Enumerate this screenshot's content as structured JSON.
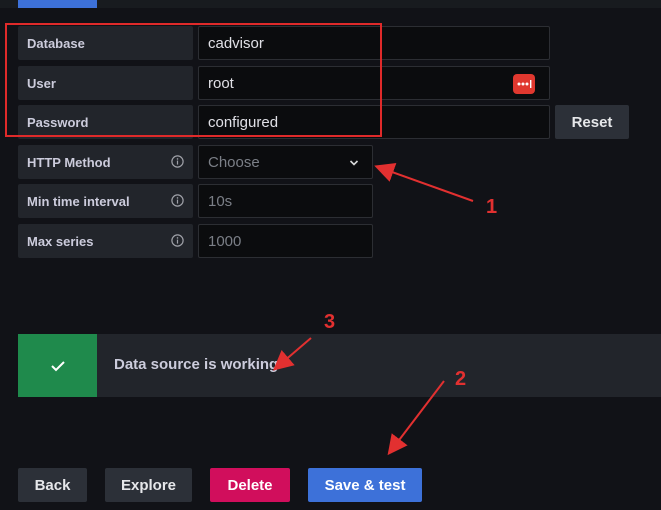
{
  "fields": {
    "database": {
      "label": "Database",
      "value": "cadvisor"
    },
    "user": {
      "label": "User",
      "value": "root"
    },
    "password": {
      "label": "Password",
      "value": "configured",
      "reset_label": "Reset"
    },
    "http_method": {
      "label": "HTTP Method",
      "placeholder": "Choose"
    },
    "min_time_interval": {
      "label": "Min time interval",
      "placeholder": "10s"
    },
    "max_series": {
      "label": "Max series",
      "placeholder": "1000"
    }
  },
  "alert": {
    "message": "Data source is working",
    "status_color": "#1f8a4c"
  },
  "buttons": {
    "back": "Back",
    "explore": "Explore",
    "delete": "Delete",
    "save_test": "Save & test"
  },
  "annotations": {
    "callout_1": "1",
    "callout_2": "2",
    "callout_3": "3",
    "highlight_color": "#e02a2a"
  },
  "colors": {
    "accent": "#3d71d9",
    "danger": "#d10e5c",
    "success": "#1f8a4c"
  }
}
